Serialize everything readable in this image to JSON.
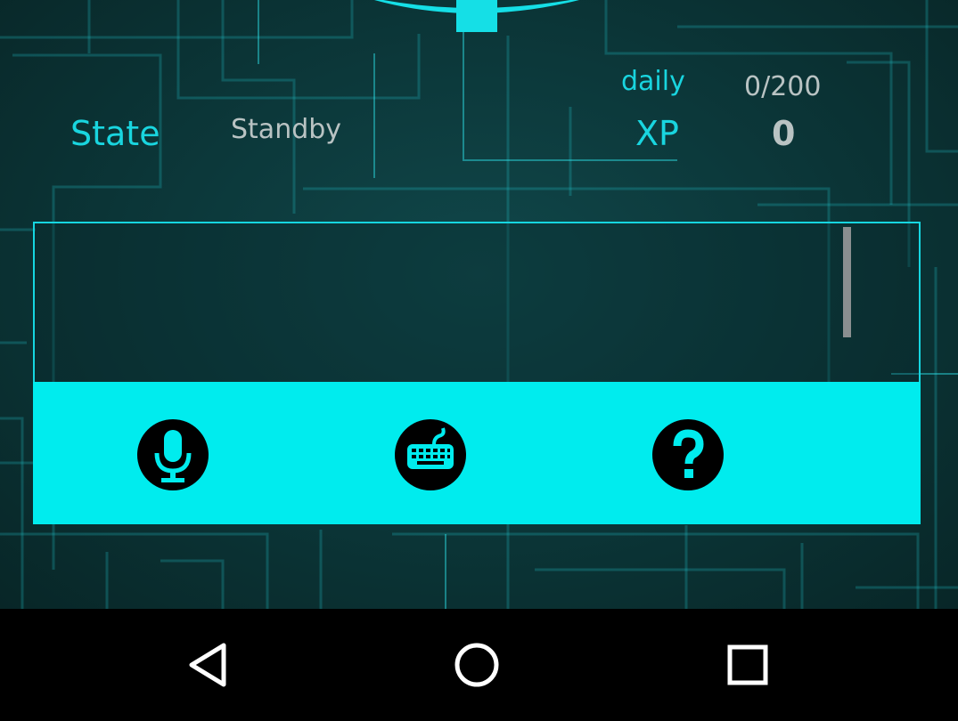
{
  "status": {
    "state_label": "State",
    "state_value": "Standby",
    "daily_label": "daily",
    "daily_value": "0/200",
    "xp_label": "XP",
    "xp_value": "0"
  },
  "output": {
    "text": ""
  },
  "actions": [
    {
      "name": "mic-button",
      "icon": "microphone-icon"
    },
    {
      "name": "keyboard-button",
      "icon": "keyboard-icon"
    },
    {
      "name": "help-button",
      "icon": "help-icon"
    }
  ],
  "navbar": {
    "back_icon": "back-triangle-icon",
    "home_icon": "home-circle-icon",
    "recents_icon": "recents-square-icon"
  },
  "colors": {
    "accent": "#00ecee",
    "label": "#19d5df",
    "value": "#b9c3c3",
    "background": "#0b3537"
  }
}
